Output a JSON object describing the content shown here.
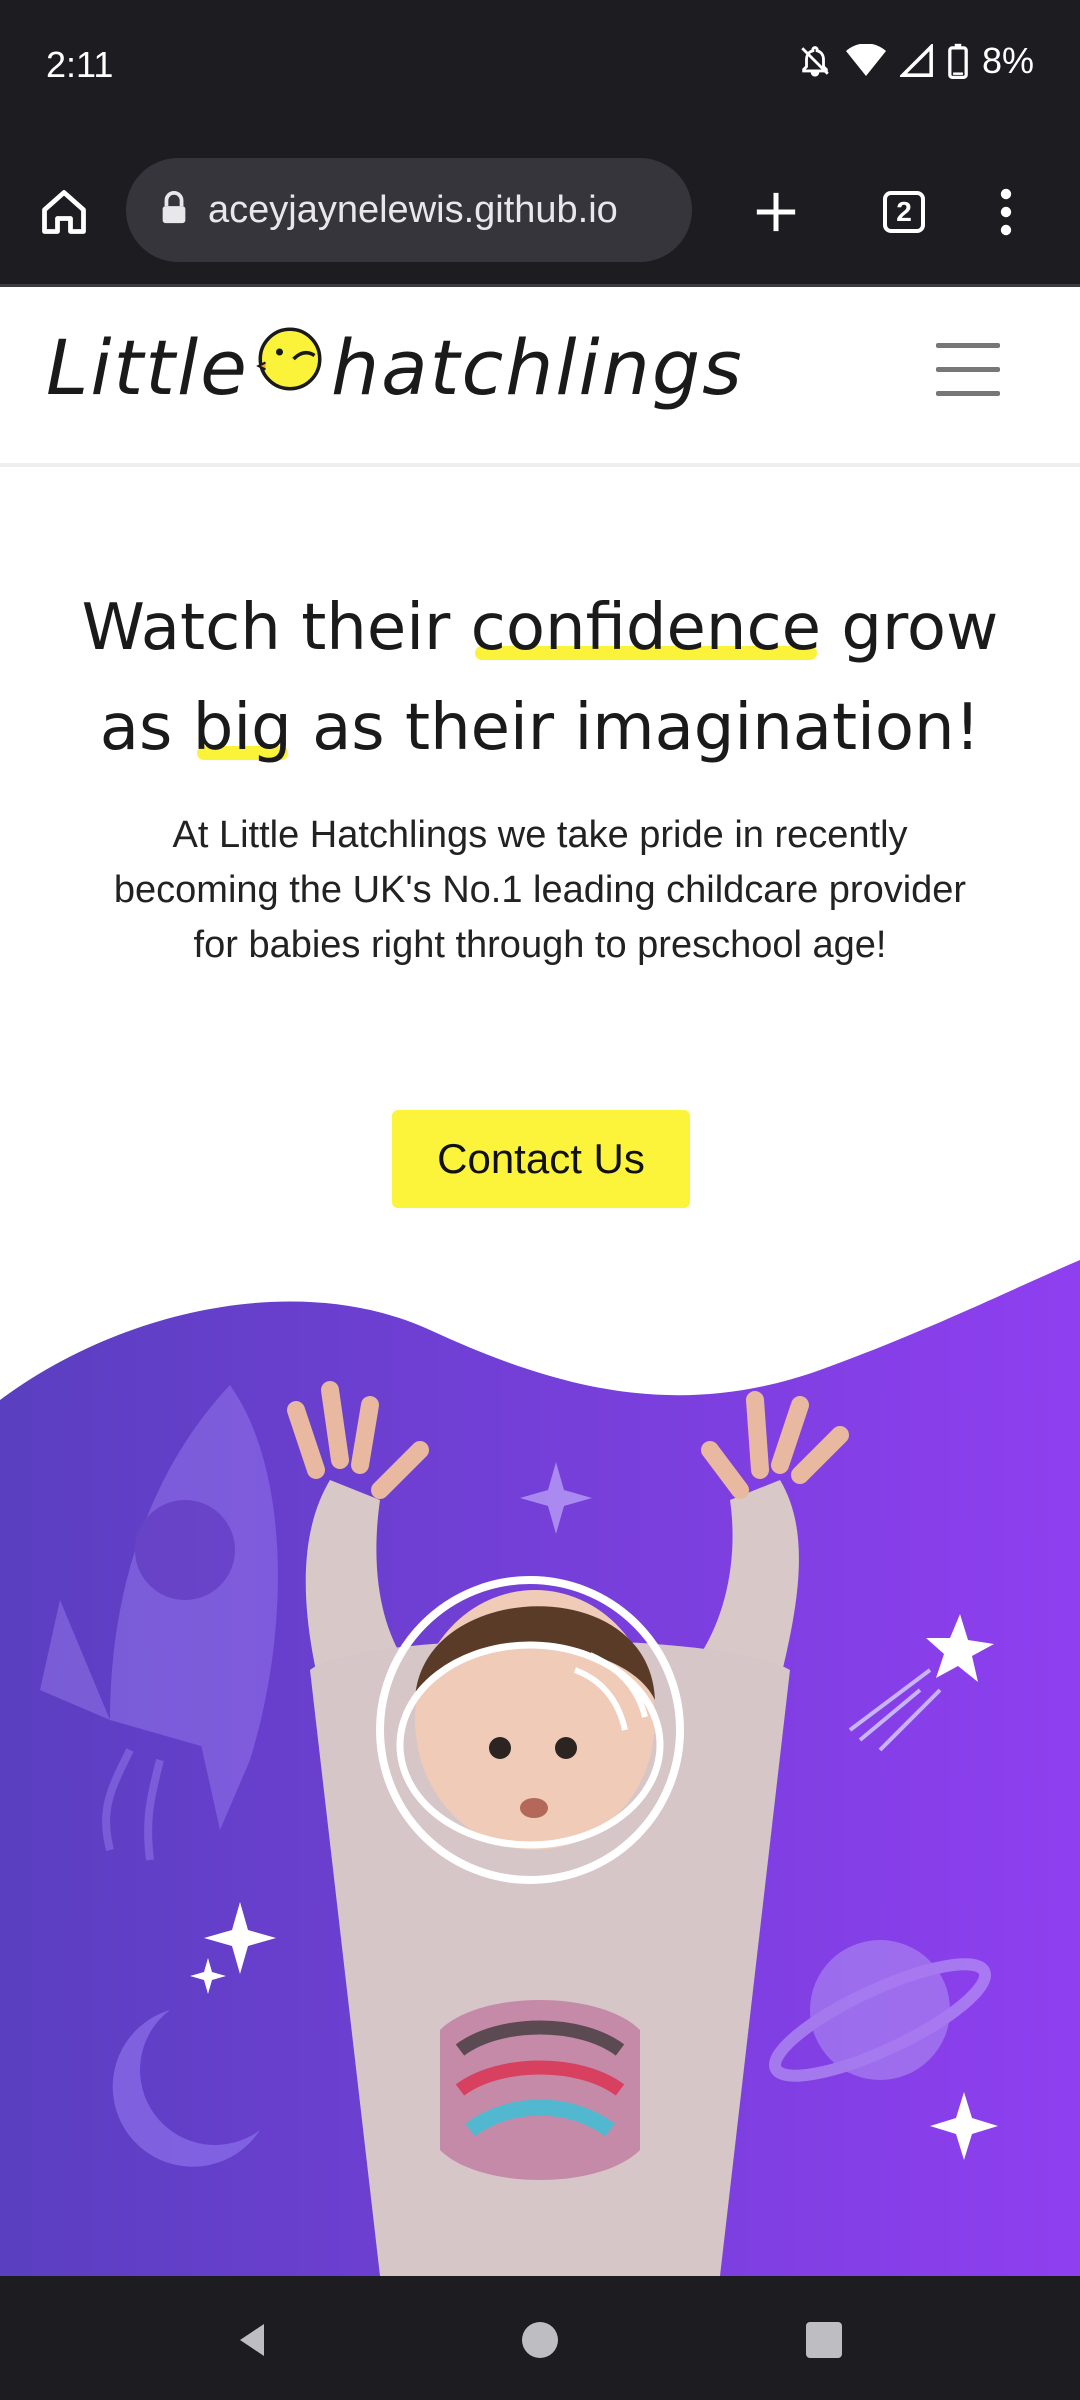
{
  "status": {
    "time": "2:11",
    "battery": "8%"
  },
  "browser": {
    "url": "aceyjaynelewis.github.io",
    "tab_count": "2"
  },
  "site": {
    "logo_text_left": "Little",
    "logo_text_right": "hatchlings"
  },
  "hero": {
    "line1_a": "Watch their ",
    "line1_hl": "confidence",
    "line1_b": " grow",
    "line2_a": "as ",
    "line2_hl": "big",
    "line2_b": " as their imagination!",
    "text": "At Little Hatchlings we take pride in recently becoming the UK's No.1 leading childcare provider for babies right through to preschool age!",
    "button": "Contact Us"
  },
  "colors": {
    "accent_yellow": "#fbf43a",
    "purple_dark": "#5a3fc0",
    "purple_light": "#8f3ff0"
  }
}
